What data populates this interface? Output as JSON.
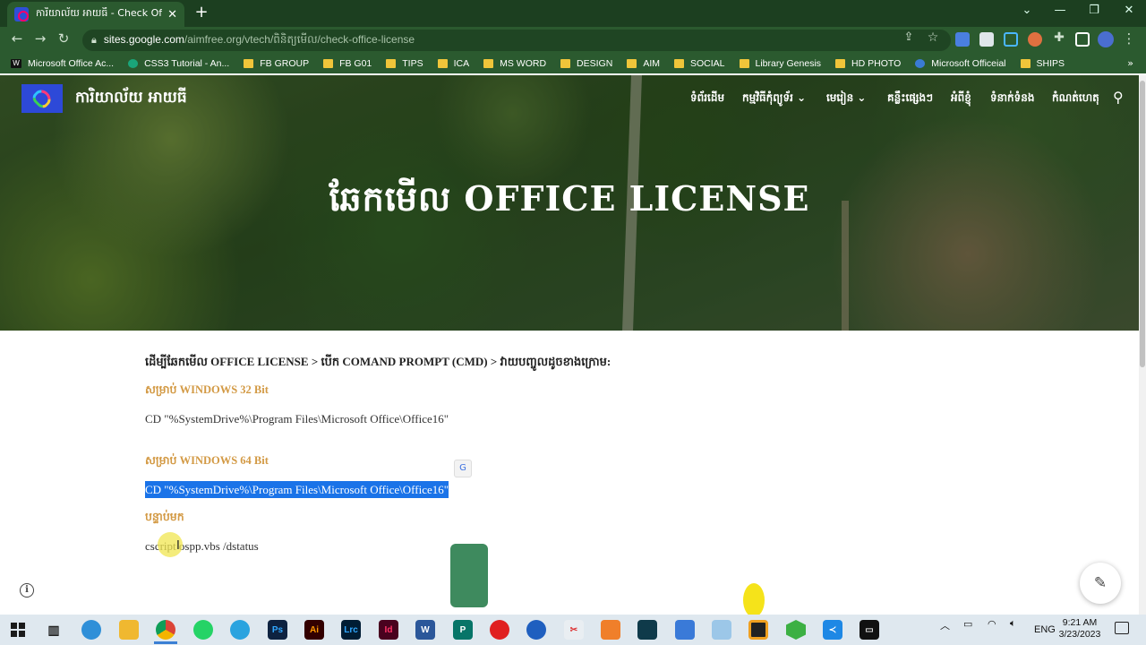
{
  "browser": {
    "tab_title": "ការិយាល័យ អាយធី - Check Office",
    "tab_close": "✕",
    "new_tab": "+",
    "url_host": "sites.google.com",
    "url_path": "/aimfree.org/vtech/ពិនិត្យមើល/check-office-license",
    "window_controls": [
      "⌄",
      "—",
      "❐",
      "✕"
    ],
    "bookmarks": [
      {
        "label": "Microsoft Office Ac...",
        "icon": "word-w-icon"
      },
      {
        "label": "CSS3 Tutorial - An...",
        "icon": "globe-icon"
      },
      {
        "label": "FB GROUP",
        "icon": "folder-icon"
      },
      {
        "label": "FB G01",
        "icon": "folder-icon"
      },
      {
        "label": "TIPS",
        "icon": "folder-icon"
      },
      {
        "label": "ICA",
        "icon": "folder-icon"
      },
      {
        "label": "MS WORD",
        "icon": "folder-icon"
      },
      {
        "label": "DESIGN",
        "icon": "folder-icon"
      },
      {
        "label": "AIM",
        "icon": "folder-icon"
      },
      {
        "label": "SOCIAL",
        "icon": "folder-icon"
      },
      {
        "label": "Library Genesis",
        "icon": "folder-icon"
      },
      {
        "label": "HD PHOTO",
        "icon": "folder-icon"
      },
      {
        "label": "Microsoft Officeial",
        "icon": "globe-icon"
      },
      {
        "label": "SHIPS",
        "icon": "folder-icon"
      }
    ],
    "bookmarks_more": "»"
  },
  "site": {
    "name": "ការិយាល័យ អាយធី",
    "nav": [
      "ទំព័រដើម",
      "កម្មវិធីកុំព្យូទ័រ",
      "មេរៀន",
      "គន្លឹះផ្សេងៗ",
      "អំពីខ្ញុំ",
      "ទំនាក់ទំនង",
      "កំណត់ហេតុ"
    ],
    "nav_dropdown_marker": "⌄",
    "hero_title": "ឆែកមើល OFFICE LICENSE"
  },
  "article": {
    "intro": "ដើម្បីឆែកមើល OFFICE LICENSE > បើក COMAND PROMPT (CMD) > វាយបញ្ចូលដូចខាងក្រោម:",
    "heading_32": "សម្រាប់ WINDOWS 32 Bit",
    "cmd_32": "CD \"%SystemDrive%\\Program Files\\Microsoft Office\\Office16\"",
    "heading_64": "សម្រាប់ WINDOWS 64 Bit",
    "cmd_64": "CD \"%SystemDrive%\\Program Files\\Microsoft Office\\Office16\"",
    "heading_next": "បន្ទាប់មក",
    "cmd_status": "cscript ospp.vbs /dstatus"
  },
  "taskbar": {
    "language": "ENG",
    "time": "9:21 AM",
    "date": "3/23/2023",
    "apps": [
      "task-view",
      "edge",
      "file-explorer",
      "chrome",
      "whatsapp",
      "telegram",
      "photoshop",
      "illustrator",
      "lightroom-classic",
      "indesign",
      "word",
      "publisher",
      "acrobat",
      "app-blue-circle",
      "snipping-tool",
      "app-orange",
      "app-dark",
      "app-blue",
      "app-light",
      "app-yellow",
      "app-green",
      "vscode",
      "terminal"
    ]
  },
  "colors": {
    "chrome_frame": "#1c3f20",
    "chrome_toolbar": "#2b5a2f",
    "heading_orange": "#d39a45",
    "selection_blue": "#1a73e8",
    "logo_blue": "#2d49d8"
  }
}
